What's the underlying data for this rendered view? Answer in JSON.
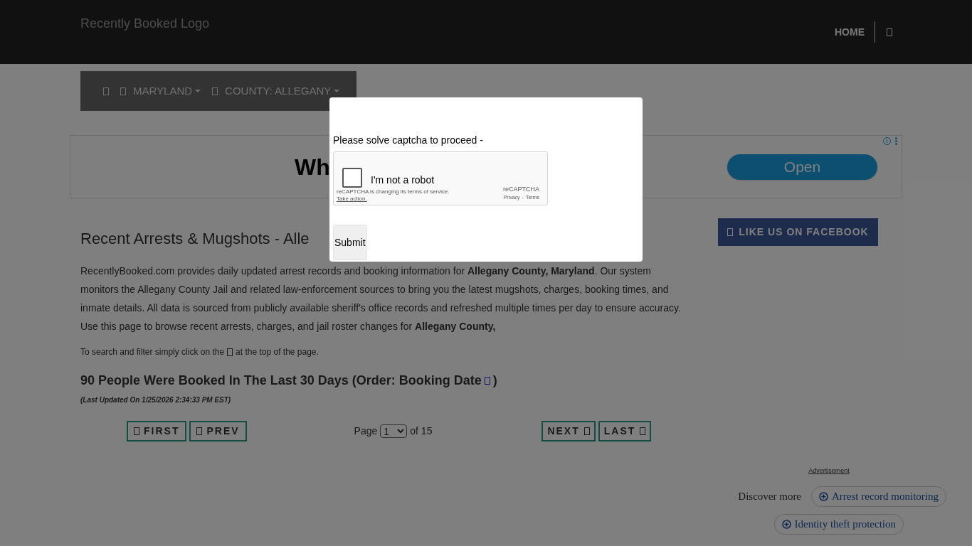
{
  "header": {
    "logo_alt": "Recently Booked Logo",
    "nav": [
      {
        "label": "HOME"
      }
    ]
  },
  "breadcrumb": {
    "items": [
      {
        "label": "MARYLAND"
      },
      {
        "label": "COUNTY: ALLEGANY"
      }
    ]
  },
  "ad_banner": {
    "headline": "Wh",
    "button": "Open"
  },
  "content": {
    "title": "Recent Arrests & Mugshots - Alle",
    "intro": "RecentlyBooked.com provides daily updated arrest records and booking information for **Allegany County, Maryland**. Our system monitors the Allegany County Jail and related law-enforcement sources to bring you the latest mugshots, charges, booking times, and inmate details. All data is sourced from publicly available sheriff's office records and refreshed multiple times per day to ensure accuracy. Use this page to browse recent arrests, charges, and jail roster changes for **Allegany County,**",
    "hint_before": "To search and filter simply click on the",
    "hint_after": "at the top of the page.",
    "count_heading": "90 People Were Booked In The Last 30 Days (Order: Booking Date",
    "count_heading_end": ")",
    "last_updated": "(Last Updated On 1/25/2026 2:34:33 PM EST)"
  },
  "pagination": {
    "first": "FIRST",
    "prev": "PREV",
    "page_label": "Page",
    "page_value": "1",
    "page_total": "of 15",
    "next": "NEXT",
    "last": "LAST"
  },
  "sidebar": {
    "facebook": "LIKE US ON FACEBOOK",
    "ad_label": "Advertisement",
    "discover": "Discover more",
    "chips": [
      {
        "label": "Arrest record monitoring"
      },
      {
        "label": "Identity theft protection"
      }
    ]
  },
  "modal": {
    "prompt": "Please solve captcha to proceed -",
    "captcha": {
      "label": "I'm not a robot",
      "checked": false,
      "notice": "reCAPTCHA is changing its terms of service.",
      "action": "Take action.",
      "brand": "reCAPTCHA",
      "privacy": "Privacy",
      "separator": "-",
      "terms": "Terms"
    },
    "submit": "Submit"
  }
}
